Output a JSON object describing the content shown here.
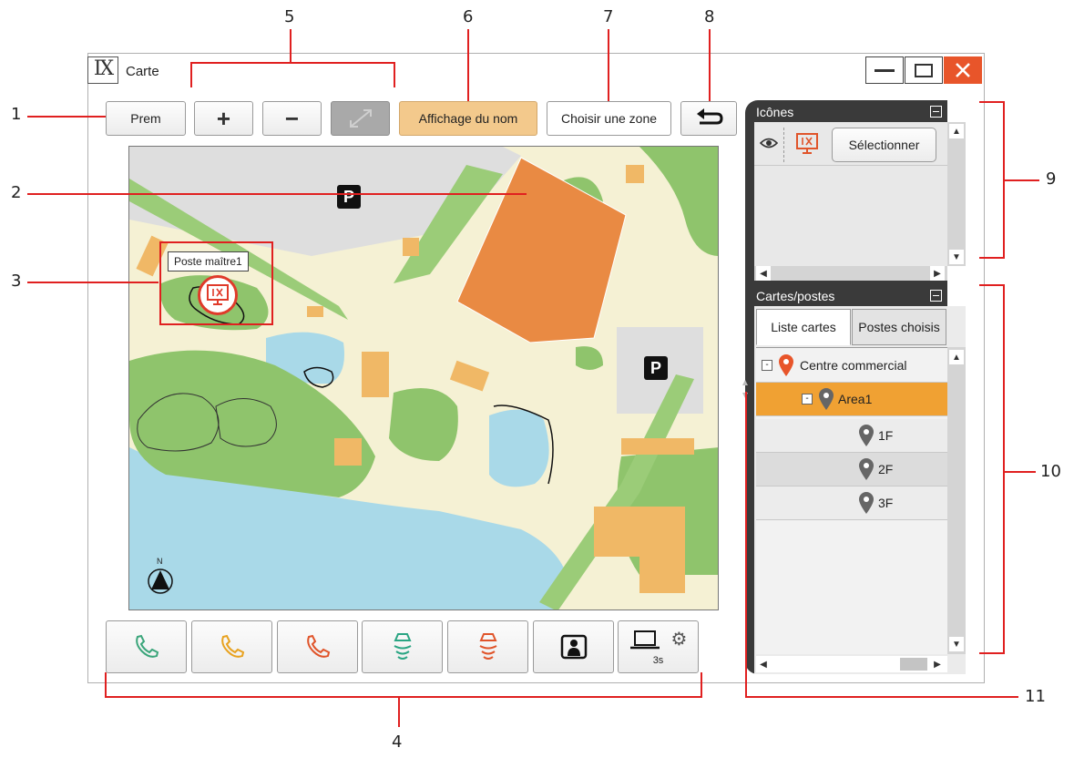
{
  "window": {
    "logo_text": "IX",
    "title": "Carte"
  },
  "toolbar": {
    "prem_label": "Prem",
    "zoom_in_label": "+",
    "zoom_out_label": "−",
    "name_display_label": "Affichage du nom",
    "choose_zone_label": "Choisir une zone"
  },
  "map": {
    "station_label": "Poste maître1",
    "parking_label": "P",
    "compass_label": "N"
  },
  "bottom_bar": {
    "timer_label": "3s"
  },
  "icons_panel": {
    "title": "Icônes",
    "select_label": "Sélectionner"
  },
  "maps_panel": {
    "title": "Cartes/postes",
    "tabs": [
      "Liste cartes",
      "Postes choisis"
    ],
    "tree": [
      {
        "label": "Centre commercial",
        "level": 0,
        "expander": "-"
      },
      {
        "label": "Area1",
        "level": 1,
        "expander": "-",
        "selected": true
      },
      {
        "label": "1F",
        "level": 2
      },
      {
        "label": "2F",
        "level": 2
      },
      {
        "label": "3F",
        "level": 2
      }
    ]
  },
  "callouts": {
    "n1": "1",
    "n2": "2",
    "n3": "3",
    "n4": "4",
    "n5": "5",
    "n6": "6",
    "n7": "7",
    "n8": "8",
    "n9": "9",
    "n10": "10",
    "n11": "11"
  },
  "colors": {
    "accent": "#f3c98c",
    "selected_row": "#f0a133",
    "close": "#e8552a",
    "callout_line": "#e02020",
    "panel_dark": "#3a3a3a"
  }
}
